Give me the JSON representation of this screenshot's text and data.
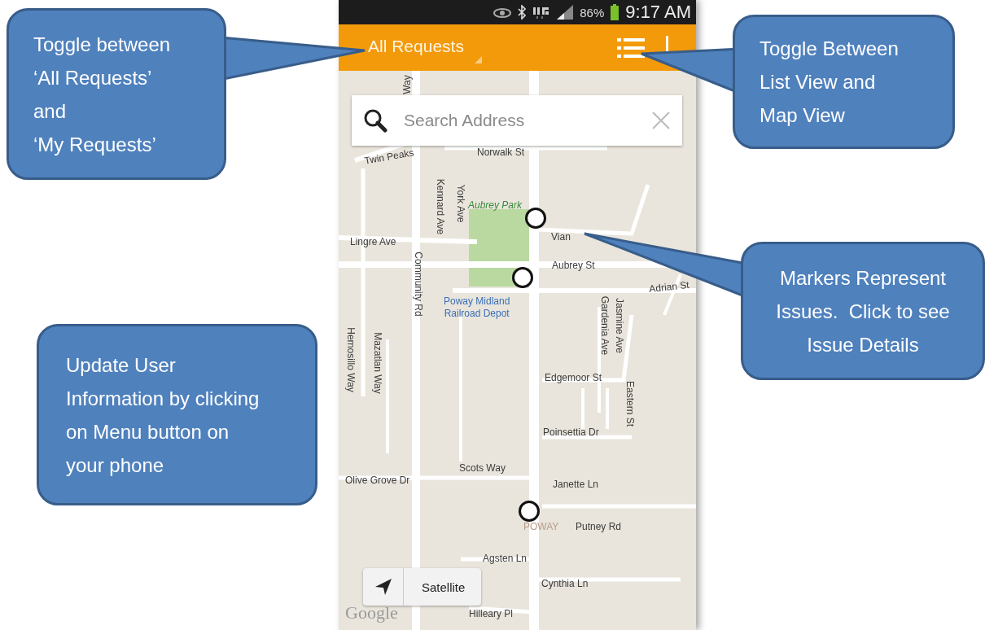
{
  "status_bar": {
    "battery": "86%",
    "time": "9:17 AM"
  },
  "toolbar": {
    "title": "All Requests"
  },
  "search": {
    "placeholder": "Search Address"
  },
  "map": {
    "labels": [
      {
        "text": "Way",
        "kind": "street"
      },
      {
        "text": "Twin Peaks",
        "kind": "street"
      },
      {
        "text": "Norwalk St",
        "kind": "street"
      },
      {
        "text": "Kennard Ave",
        "kind": "street"
      },
      {
        "text": "York Ave",
        "kind": "street"
      },
      {
        "text": "Aubrey Park",
        "kind": "park"
      },
      {
        "text": "Vian",
        "kind": "street"
      },
      {
        "text": "Lingre Ave",
        "kind": "street"
      },
      {
        "text": "Aubrey St",
        "kind": "street"
      },
      {
        "text": "Community Rd",
        "kind": "street"
      },
      {
        "text": "Adrian St",
        "kind": "street"
      },
      {
        "text": "Poway Midland\nRailroad Depot",
        "kind": "poi"
      },
      {
        "text": "Jasmine Ave",
        "kind": "street"
      },
      {
        "text": "Gardenia Ave",
        "kind": "street"
      },
      {
        "text": "Hemosillo Way",
        "kind": "street"
      },
      {
        "text": "Mazatlan Way",
        "kind": "street"
      },
      {
        "text": "Edgemoor St",
        "kind": "street"
      },
      {
        "text": "Eastern St",
        "kind": "street"
      },
      {
        "text": "Poinsettia Dr",
        "kind": "street"
      },
      {
        "text": "Scots Way",
        "kind": "street"
      },
      {
        "text": "Olive Grove Dr",
        "kind": "street"
      },
      {
        "text": "Janette Ln",
        "kind": "street"
      },
      {
        "text": "POWAY",
        "kind": "town"
      },
      {
        "text": "Putney Rd",
        "kind": "street"
      },
      {
        "text": "Agsten Ln",
        "kind": "street"
      },
      {
        "text": "Cynthia Ln",
        "kind": "street"
      },
      {
        "text": "Hilleary Pl",
        "kind": "street"
      }
    ],
    "satellite_button": "Satellite",
    "attribution": "Google"
  },
  "callouts": [
    {
      "text": "Toggle between\n‘All Requests’\nand\n‘My Requests’"
    },
    {
      "text": "Toggle Between\nList View and\nMap View"
    },
    {
      "text": "Markers Represent\nIssues.  Click to see\nIssue Details"
    },
    {
      "text": "Update User\nInformation by clicking\non Menu button on\nyour phone"
    }
  ]
}
